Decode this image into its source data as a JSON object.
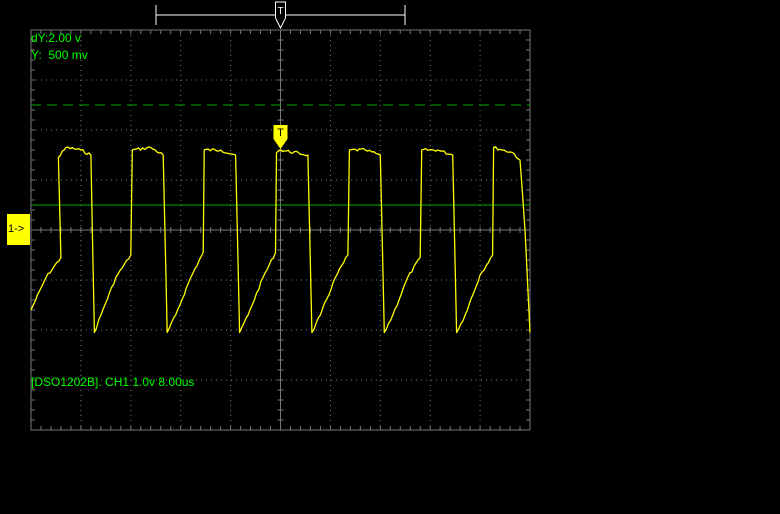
{
  "colors": {
    "background": "#000000",
    "grid": "#777777",
    "trace": "#ffff00",
    "readout_text": "#00ff00",
    "cursor_line": "#00aa00",
    "trigger_bracket": "#ffffff"
  },
  "readouts": {
    "cursor_dy": "dY:2.00 v",
    "cursor_y": "Y:  500 mv"
  },
  "status_line": "[DSO1202B]. CH1 1.0v 8.00us",
  "channel_marker": "1->",
  "trigger_marker": "T",
  "chart_data": {
    "type": "line",
    "title": "",
    "xlabel": "",
    "ylabel": "",
    "grid": true,
    "time_per_div_us": 8.0,
    "volts_per_div": 1.0,
    "xlim_div": [
      -5,
      5
    ],
    "ylim_div": [
      -4,
      4
    ],
    "cursor_levels_div": [
      2.5,
      0.5
    ],
    "series": [
      {
        "channel": "CH1",
        "points": [
          [
            -5.0,
            -1.6
          ],
          [
            -4.7,
            -0.95
          ],
          [
            -4.4,
            -0.55
          ],
          [
            -4.45,
            1.45
          ],
          [
            -4.3,
            1.65
          ],
          [
            -4.0,
            1.6
          ],
          [
            -3.8,
            1.5
          ],
          [
            -3.73,
            -2.05
          ],
          [
            -3.6,
            -1.7
          ],
          [
            -3.3,
            -0.95
          ],
          [
            -3.0,
            -0.5
          ],
          [
            -2.97,
            1.6
          ],
          [
            -2.6,
            1.65
          ],
          [
            -2.35,
            1.5
          ],
          [
            -2.27,
            -2.05
          ],
          [
            -2.1,
            -1.7
          ],
          [
            -1.8,
            -0.95
          ],
          [
            -1.55,
            -0.45
          ],
          [
            -1.53,
            1.6
          ],
          [
            -1.2,
            1.6
          ],
          [
            -0.9,
            1.5
          ],
          [
            -0.82,
            -2.05
          ],
          [
            -0.65,
            -1.7
          ],
          [
            -0.35,
            -0.95
          ],
          [
            -0.1,
            -0.45
          ],
          [
            -0.08,
            1.55
          ],
          [
            0.0,
            1.6
          ],
          [
            0.55,
            1.5
          ],
          [
            0.63,
            -2.05
          ],
          [
            0.8,
            -1.7
          ],
          [
            1.1,
            -0.95
          ],
          [
            1.35,
            -0.5
          ],
          [
            1.38,
            1.6
          ],
          [
            1.7,
            1.6
          ],
          [
            2.0,
            1.5
          ],
          [
            2.08,
            -2.05
          ],
          [
            2.25,
            -1.7
          ],
          [
            2.55,
            -0.95
          ],
          [
            2.8,
            -0.55
          ],
          [
            2.83,
            1.6
          ],
          [
            3.15,
            1.6
          ],
          [
            3.45,
            1.5
          ],
          [
            3.53,
            -2.05
          ],
          [
            3.7,
            -1.7
          ],
          [
            4.0,
            -0.9
          ],
          [
            4.25,
            -0.5
          ],
          [
            4.27,
            1.65
          ],
          [
            4.65,
            1.55
          ],
          [
            4.8,
            1.4
          ],
          [
            4.9,
            0.0
          ],
          [
            5.0,
            -2.05
          ]
        ]
      }
    ]
  }
}
